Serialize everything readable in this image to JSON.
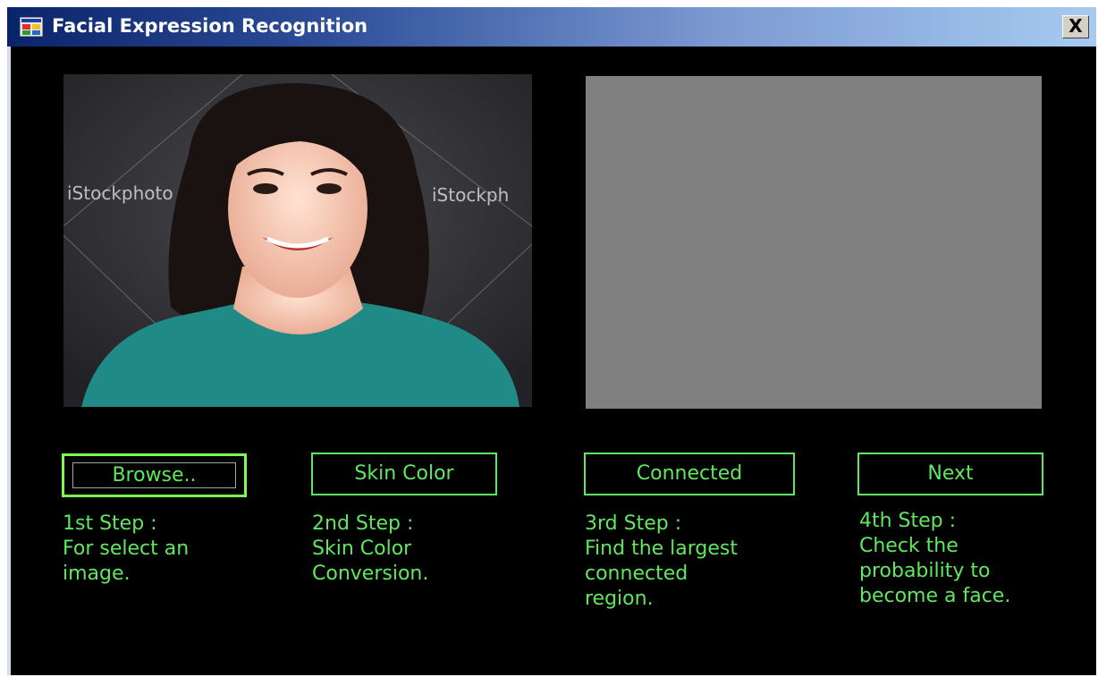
{
  "window": {
    "title": "Facial Expression Recognition",
    "close_label": "X"
  },
  "image": {
    "watermark_left": "iStockphoto",
    "watermark_right": "iStockph"
  },
  "buttons": {
    "browse": "Browse..",
    "skin_color": "Skin Color",
    "connected": "Connected",
    "next": "Next"
  },
  "steps": {
    "step1": "1st Step :\nFor select an\nimage.",
    "step2": "2nd Step :\nSkin Color\nConversion.",
    "step3": "3rd Step :\nFind the largest\nconnected\nregion.",
    "step4": "4th Step :\nCheck the\nprobability to\nbecome a face."
  },
  "colors": {
    "accent_green": "#5fe85f",
    "output_gray": "#808080",
    "background": "#000000"
  }
}
